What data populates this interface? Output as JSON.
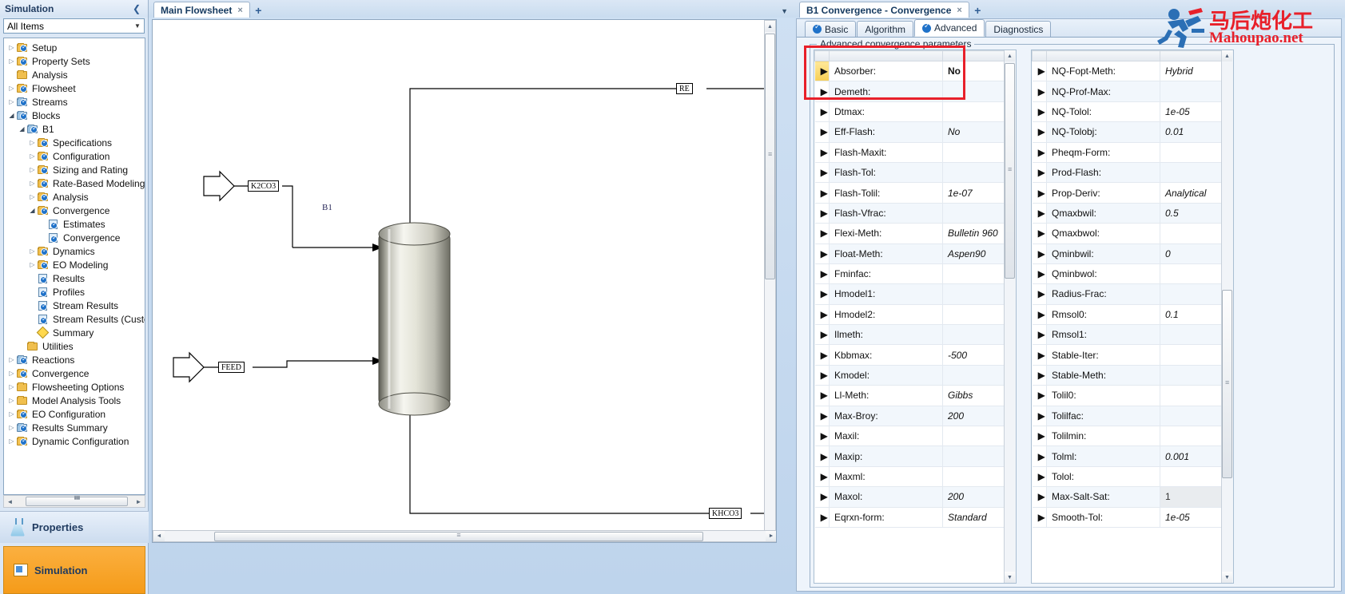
{
  "left_panel": {
    "title": "Simulation",
    "collapse_icon": "chevron-left",
    "filter_value": "All Items",
    "tree": [
      {
        "label": "Setup",
        "depth": 0,
        "icon": "folder-check",
        "expander": "collapsed"
      },
      {
        "label": "Property Sets",
        "depth": 0,
        "icon": "folder-check",
        "expander": "collapsed"
      },
      {
        "label": "Analysis",
        "depth": 0,
        "icon": "folder",
        "expander": "none"
      },
      {
        "label": "Flowsheet",
        "depth": 0,
        "icon": "folder-check",
        "expander": "collapsed"
      },
      {
        "label": "Streams",
        "depth": 0,
        "icon": "folder-blue-check",
        "expander": "collapsed"
      },
      {
        "label": "Blocks",
        "depth": 0,
        "icon": "folder-blue-check",
        "expander": "expanded"
      },
      {
        "label": "B1",
        "depth": 1,
        "icon": "folder-blue-check",
        "expander": "expanded"
      },
      {
        "label": "Specifications",
        "depth": 2,
        "icon": "folder-check",
        "expander": "collapsed"
      },
      {
        "label": "Configuration",
        "depth": 2,
        "icon": "folder-check",
        "expander": "collapsed"
      },
      {
        "label": "Sizing and Rating",
        "depth": 2,
        "icon": "folder-check",
        "expander": "collapsed"
      },
      {
        "label": "Rate-Based Modeling",
        "depth": 2,
        "icon": "folder-check",
        "expander": "collapsed"
      },
      {
        "label": "Analysis",
        "depth": 2,
        "icon": "folder-check",
        "expander": "collapsed"
      },
      {
        "label": "Convergence",
        "depth": 2,
        "icon": "folder-check",
        "expander": "expanded"
      },
      {
        "label": "Estimates",
        "depth": 3,
        "icon": "sheet-check",
        "expander": "none"
      },
      {
        "label": "Convergence",
        "depth": 3,
        "icon": "sheet-check",
        "expander": "none"
      },
      {
        "label": "Dynamics",
        "depth": 2,
        "icon": "folder-check",
        "expander": "collapsed"
      },
      {
        "label": "EO Modeling",
        "depth": 2,
        "icon": "folder-check",
        "expander": "collapsed"
      },
      {
        "label": "Results",
        "depth": 2,
        "icon": "sheet-check",
        "expander": "none"
      },
      {
        "label": "Profiles",
        "depth": 2,
        "icon": "sheet-check",
        "expander": "none"
      },
      {
        "label": "Stream Results",
        "depth": 2,
        "icon": "sheet-check",
        "expander": "none"
      },
      {
        "label": "Stream Results (Custor",
        "depth": 2,
        "icon": "sheet-check",
        "expander": "none"
      },
      {
        "label": "Summary",
        "depth": 2,
        "icon": "summary-diamond",
        "expander": "none"
      },
      {
        "label": "Utilities",
        "depth": 1,
        "icon": "folder",
        "expander": "none"
      },
      {
        "label": "Reactions",
        "depth": 0,
        "icon": "folder-blue-check",
        "expander": "collapsed"
      },
      {
        "label": "Convergence",
        "depth": 0,
        "icon": "folder-check",
        "expander": "collapsed"
      },
      {
        "label": "Flowsheeting Options",
        "depth": 0,
        "icon": "folder",
        "expander": "collapsed"
      },
      {
        "label": "Model Analysis Tools",
        "depth": 0,
        "icon": "folder",
        "expander": "collapsed"
      },
      {
        "label": "EO Configuration",
        "depth": 0,
        "icon": "folder-check",
        "expander": "collapsed"
      },
      {
        "label": "Results Summary",
        "depth": 0,
        "icon": "folder-blue-check",
        "expander": "collapsed"
      },
      {
        "label": "Dynamic Configuration",
        "depth": 0,
        "icon": "folder-check",
        "expander": "collapsed"
      }
    ],
    "nav": {
      "properties": "Properties",
      "simulation": "Simulation"
    }
  },
  "center": {
    "tab_label": "Main Flowsheet",
    "tab_close": "×",
    "new_tab": "+",
    "overflow_caret": "▼",
    "block_label": "B1",
    "streams": [
      {
        "name": "K2CO3"
      },
      {
        "name": "FEED"
      },
      {
        "name": "RE"
      },
      {
        "name": "KHCO3"
      }
    ]
  },
  "right": {
    "tab_label": "B1 Convergence - Convergence",
    "tab_close": "×",
    "new_tab": "+",
    "subtabs": [
      {
        "label": "Basic",
        "icon": "blue-check",
        "active": false
      },
      {
        "label": "Algorithm",
        "icon": "none",
        "active": false
      },
      {
        "label": "Advanced",
        "icon": "blue-check",
        "active": true
      },
      {
        "label": "Diagnostics",
        "icon": "none",
        "active": false
      }
    ],
    "group_title": "Advanced convergence parameters",
    "table_left": [
      {
        "name": "Absorber:",
        "value": "No",
        "current": true
      },
      {
        "name": "Demeth:",
        "value": ""
      },
      {
        "name": "Dtmax:",
        "value": ""
      },
      {
        "name": "Eff-Flash:",
        "value": "No"
      },
      {
        "name": "Flash-Maxit:",
        "value": ""
      },
      {
        "name": "Flash-Tol:",
        "value": ""
      },
      {
        "name": "Flash-Tolil:",
        "value": "1e-07"
      },
      {
        "name": "Flash-Vfrac:",
        "value": ""
      },
      {
        "name": "Flexi-Meth:",
        "value": "Bulletin 960"
      },
      {
        "name": "Float-Meth:",
        "value": "Aspen90"
      },
      {
        "name": "Fminfac:",
        "value": ""
      },
      {
        "name": "Hmodel1:",
        "value": ""
      },
      {
        "name": "Hmodel2:",
        "value": ""
      },
      {
        "name": "Ilmeth:",
        "value": ""
      },
      {
        "name": "Kbbmax:",
        "value": "-500"
      },
      {
        "name": "Kmodel:",
        "value": ""
      },
      {
        "name": "Ll-Meth:",
        "value": "Gibbs"
      },
      {
        "name": "Max-Broy:",
        "value": "200"
      },
      {
        "name": "Maxil:",
        "value": ""
      },
      {
        "name": "Maxip:",
        "value": ""
      },
      {
        "name": "Maxml:",
        "value": ""
      },
      {
        "name": "Maxol:",
        "value": "200"
      },
      {
        "name": "Eqrxn-form:",
        "value": "Standard"
      }
    ],
    "table_right": [
      {
        "name": "NQ-Fopt-Meth:",
        "value": "Hybrid"
      },
      {
        "name": "NQ-Prof-Max:",
        "value": ""
      },
      {
        "name": "NQ-Tolol:",
        "value": "1e-05"
      },
      {
        "name": "NQ-Tolobj:",
        "value": "0.01"
      },
      {
        "name": "Pheqm-Form:",
        "value": ""
      },
      {
        "name": "Prod-Flash:",
        "value": ""
      },
      {
        "name": "Prop-Deriv:",
        "value": "Analytical"
      },
      {
        "name": "Qmaxbwil:",
        "value": "0.5"
      },
      {
        "name": "Qmaxbwol:",
        "value": ""
      },
      {
        "name": "Qminbwil:",
        "value": "0"
      },
      {
        "name": "Qminbwol:",
        "value": ""
      },
      {
        "name": "Radius-Frac:",
        "value": ""
      },
      {
        "name": "Rmsol0:",
        "value": "0.1"
      },
      {
        "name": "Rmsol1:",
        "value": ""
      },
      {
        "name": "Stable-Iter:",
        "value": ""
      },
      {
        "name": "Stable-Meth:",
        "value": ""
      },
      {
        "name": "Tolil0:",
        "value": ""
      },
      {
        "name": "Tolilfac:",
        "value": ""
      },
      {
        "name": "Tolilmin:",
        "value": ""
      },
      {
        "name": "Tolml:",
        "value": "0.001"
      },
      {
        "name": "Tolol:",
        "value": ""
      },
      {
        "name": "Max-Salt-Sat:",
        "value": "1",
        "readonly": true
      },
      {
        "name": "Smooth-Tol:",
        "value": "1e-05"
      }
    ]
  },
  "watermark": {
    "chinese": "马后炮化工",
    "english": "Mahoupao.net"
  },
  "colors": {
    "accent": "#1f72c9",
    "value_blue": "#1430d4",
    "highlight_red": "#e8202a",
    "nav_orange": "#fbb040"
  }
}
